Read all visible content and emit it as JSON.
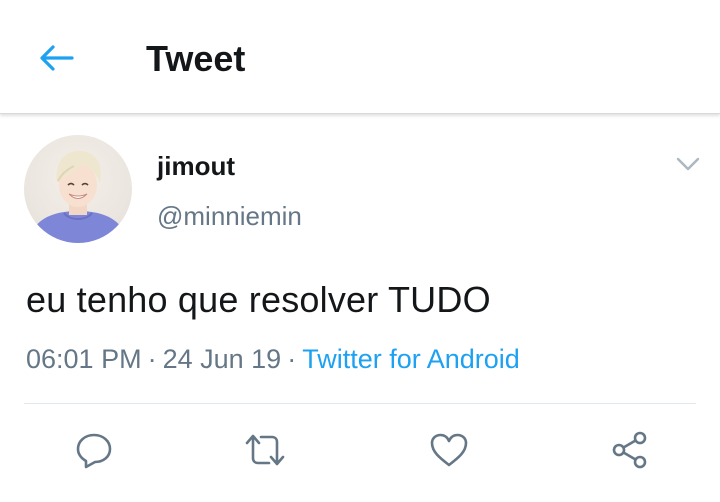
{
  "header": {
    "title": "Tweet",
    "back_icon": "arrow-left-icon"
  },
  "tweet": {
    "display_name": "jimout",
    "handle": "@minniemin",
    "text": "eu tenho que resolver TUDO",
    "time": "06:01 PM",
    "separator": "·",
    "date": "24 Jun 19",
    "source": "Twitter for Android"
  },
  "actions": [
    {
      "icon": "reply-icon"
    },
    {
      "icon": "retweet-icon"
    },
    {
      "icon": "like-icon"
    },
    {
      "icon": "share-icon"
    }
  ],
  "colors": {
    "accent": "#1da1f2",
    "secondary_text": "#657786",
    "primary_text": "#14171a",
    "divider": "#e1e8ed"
  }
}
